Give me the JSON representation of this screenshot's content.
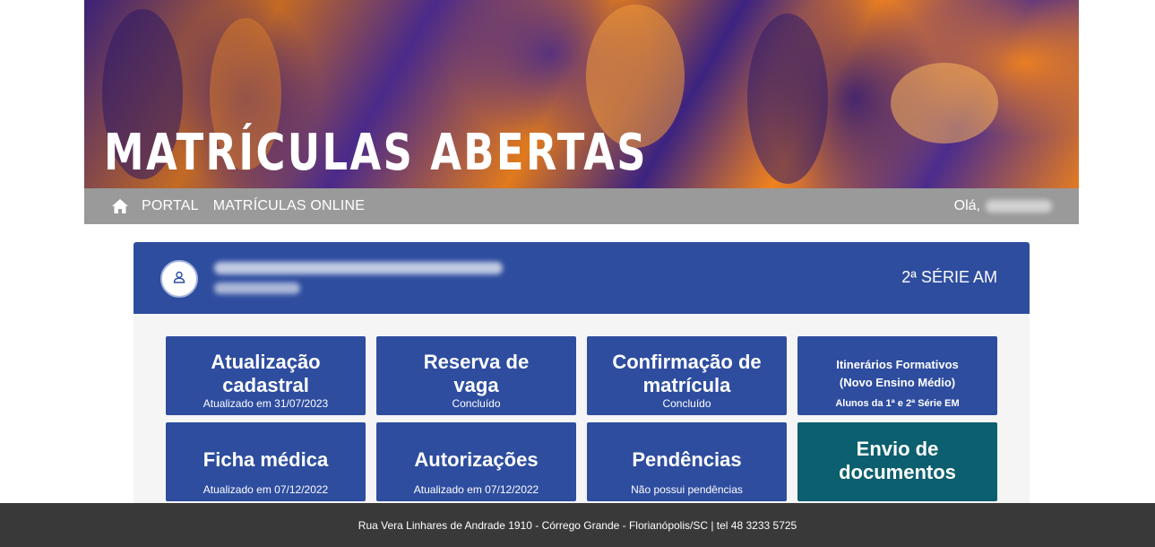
{
  "banner": {
    "title": "MATRÍCULAS ABERTAS"
  },
  "nav": {
    "home_icon": "home-icon",
    "links": [
      "PORTAL",
      "MATRÍCULAS ONLINE"
    ],
    "greeting": "Olá,"
  },
  "student": {
    "avatar_icon": "user-icon",
    "grade": "2ª SÉRIE AM"
  },
  "tiles": [
    {
      "title": "Atualização cadastral",
      "subtitle": "Atualizado em 31/07/2023"
    },
    {
      "title": "Reserva de vaga",
      "subtitle": "Concluído"
    },
    {
      "title": "Confirmação de matrícula",
      "subtitle": "Concluído"
    },
    {
      "title": "Itinerários Formativos (Novo Ensino Médio)",
      "subtitle": "Alunos da 1ª e 2ª Série EM"
    },
    {
      "title": "Ficha médica",
      "subtitle": "Atualizado em 07/12/2022"
    },
    {
      "title": "Autorizações",
      "subtitle": "Atualizado em 07/12/2022"
    },
    {
      "title": "Pendências",
      "subtitle": "Não possui pendências"
    },
    {
      "title": "Envio de documentos",
      "subtitle": ""
    }
  ],
  "footer": {
    "text": "Rua Vera Linhares de Andrade 1910 - Córrego Grande - Florianópolis/SC | tel 48 3233 5725"
  },
  "colors": {
    "primary": "#2e4d9f",
    "teal": "#0c5f6e",
    "nav": "#9a9a9a",
    "footer": "#393939"
  }
}
